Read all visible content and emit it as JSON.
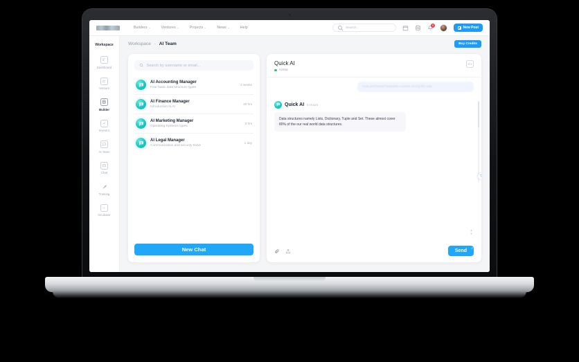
{
  "topbar": {
    "logo_name": "brand-logo",
    "nav": [
      {
        "label": "Builders",
        "has_caret": true
      },
      {
        "label": "Ventures",
        "has_caret": true
      },
      {
        "label": "Projects",
        "has_caret": true
      },
      {
        "label": "News",
        "has_caret": true
      },
      {
        "label": "Help",
        "has_caret": false
      }
    ],
    "search_placeholder": "Search...",
    "icons": [
      "calendar-icon",
      "database-icon",
      "bell-icon"
    ],
    "notification_count": "5",
    "new_post_label": "New Post"
  },
  "sidebar": {
    "title": "Workspace",
    "items": [
      {
        "label": "Dashboard",
        "icon": "dashboard-icon",
        "active": false
      },
      {
        "label": "Venture",
        "icon": "venture-icon",
        "active": false
      },
      {
        "label": "Builder",
        "icon": "builder-icon",
        "active": true
      },
      {
        "label": "Investor",
        "icon": "investor-icon",
        "active": false
      },
      {
        "label": "AI Team",
        "icon": "ai-team-icon",
        "active": false
      },
      {
        "label": "Chat",
        "icon": "chat-icon",
        "active": false
      },
      {
        "label": "Training",
        "icon": "training-icon",
        "active": false
      },
      {
        "label": "Incubator",
        "icon": "incubator-icon",
        "active": false
      }
    ]
  },
  "breadcrumb": {
    "root": "Workspace",
    "separator": "-",
    "current": "AI Team",
    "buy_credits_label": "Buy Credits"
  },
  "list_panel": {
    "search_placeholder": "Search by username or email...",
    "agents": [
      {
        "name": "AI Accounting Manager",
        "subtitle": "Four basic data structure types",
        "time": "2 weeks"
      },
      {
        "name": "AI Finance Manager",
        "subtitle": "Introduction to AI",
        "time": "20 hrs"
      },
      {
        "name": "AI Marketing Manager",
        "subtitle": "Operating Systems types",
        "time": "3 hrs"
      },
      {
        "name": "AI Legal Manager",
        "subtitle": "Communication and security tricks",
        "time": "1 day"
      }
    ],
    "new_chat_label": "New Chat"
  },
  "chat": {
    "title": "Quick AI",
    "status": "Active",
    "menu_icon": "more-options-icon",
    "messages": [
      {
        "role": "user",
        "text": "most purchased business courses during the sale.",
        "faded": true
      },
      {
        "role": "assistant",
        "sender": "Quick AI",
        "time": "5 Hours",
        "text": "Data structures namely Lists, Dictionary, Tuple and Set. These almost cover 80% of the our real world data structures."
      }
    ],
    "composer": {
      "attach_icon": "paperclip-icon",
      "upload_icon": "share-upload-icon",
      "send_label": "Send"
    },
    "help_icon": "help-circle-icon"
  },
  "colors": {
    "accent_blue": "#21a7f7",
    "avatar_teal": "#17c9c2",
    "status_green": "#2cc56f",
    "badge_red": "#ef3e4a"
  }
}
